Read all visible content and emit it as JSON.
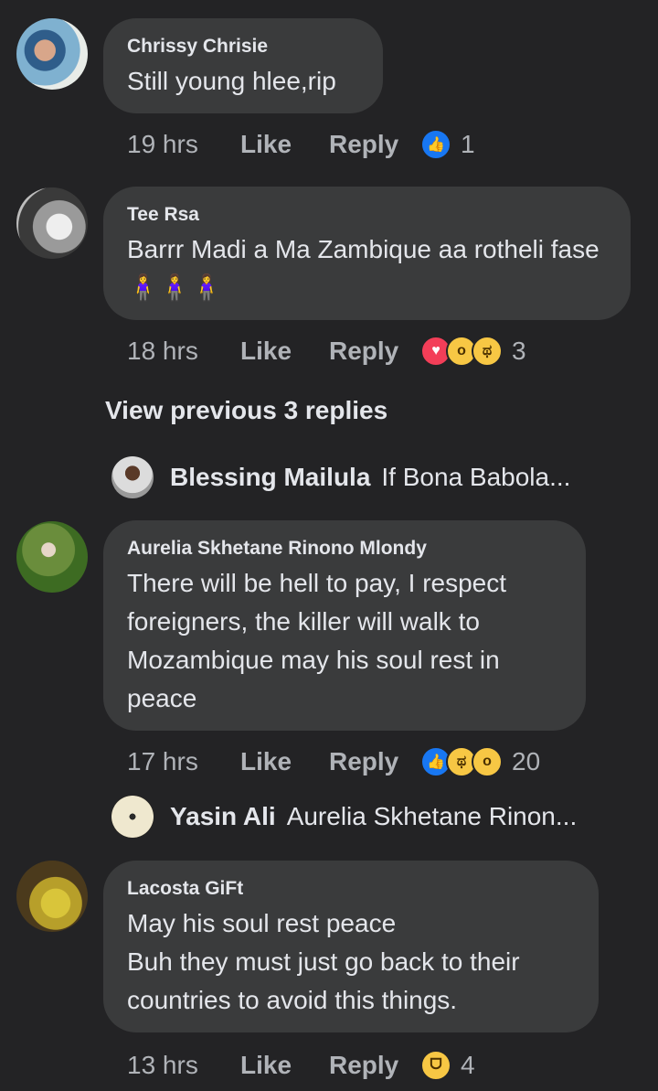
{
  "comments": [
    {
      "author": "Chrissy Chrisie",
      "text": "Still young hlee,rip",
      "time": "19 hrs",
      "like": "Like",
      "reply": "Reply",
      "reactions": [
        "like"
      ],
      "count": "1"
    },
    {
      "author": "Tee Rsa",
      "text": "Barrr Madi a Ma Zambique  aa rotheli fase 🧍‍♀️🧍‍♀️🧍‍♀️",
      "time": "18 hrs",
      "like": "Like",
      "reply": "Reply",
      "reactions": [
        "love",
        "wow",
        "sad"
      ],
      "count": "3"
    },
    {
      "author": "Aurelia Skhetane Rinono Mlondy",
      "text": "There will be hell to pay,  I respect foreigners,  the killer will walk to Mozambique  may his soul rest in peace",
      "time": "17 hrs",
      "like": "Like",
      "reply": "Reply",
      "reactions": [
        "like",
        "sad",
        "wow"
      ],
      "count": "20"
    },
    {
      "author": "Lacosta GiFt",
      "text": "May his soul rest peace\nBuh they must just go back to their countries to avoid this things.",
      "time": "13 hrs",
      "like": "Like",
      "reply": "Reply",
      "reactions": [
        "haha"
      ],
      "count": "4"
    }
  ],
  "view_previous": "View previous 3 replies",
  "replies": [
    {
      "name": "Blessing Mailula",
      "snippet": "If Bona Babola..."
    },
    {
      "name": "Yasin Ali",
      "snippet": "Aurelia Skhetane Rinon..."
    }
  ],
  "colors": {
    "background": "#232325",
    "bubble": "#3a3b3c",
    "like_blue": "#1877f2",
    "love_red": "#f33e58",
    "emoji_yellow": "#f7c744"
  }
}
